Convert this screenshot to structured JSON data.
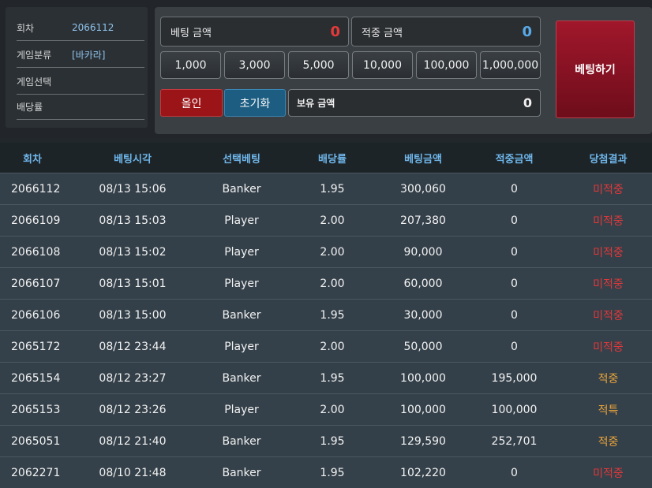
{
  "info": {
    "rows": [
      {
        "label": "회차",
        "value": "2066112"
      },
      {
        "label": "게임분류",
        "value": "[바카라]"
      },
      {
        "label": "게임선택",
        "value": ""
      },
      {
        "label": "배당률",
        "value": ""
      }
    ]
  },
  "bet": {
    "bet_amount_label": "베팅 금액",
    "bet_amount_value": "0",
    "win_amount_label": "적중 금액",
    "win_amount_value": "0",
    "chips": [
      "1,000",
      "3,000",
      "5,000",
      "10,000",
      "100,000",
      "1,000,000"
    ],
    "allin_label": "올인",
    "reset_label": "초기화",
    "holding_label": "보유 금액",
    "holding_value": "0",
    "submit_label": "베팅하기"
  },
  "colors": {
    "bet_amount": "#e23a3a",
    "win_amount": "#58a9e6",
    "header_text": "#6fb6ea",
    "result_miss": "#e0383b",
    "result_hit": "#e8a33a"
  },
  "table": {
    "headers": [
      "회차",
      "베팅시각",
      "선택베팅",
      "배당률",
      "베팅금액",
      "적중금액",
      "당첨결과"
    ],
    "rows": [
      [
        "2066112",
        "08/13 15:06",
        "Banker",
        "1.95",
        "300,060",
        "0",
        "미적중"
      ],
      [
        "2066109",
        "08/13 15:03",
        "Player",
        "2.00",
        "207,380",
        "0",
        "미적중"
      ],
      [
        "2066108",
        "08/13 15:02",
        "Player",
        "2.00",
        "90,000",
        "0",
        "미적중"
      ],
      [
        "2066107",
        "08/13 15:01",
        "Player",
        "2.00",
        "60,000",
        "0",
        "미적중"
      ],
      [
        "2066106",
        "08/13 15:00",
        "Banker",
        "1.95",
        "30,000",
        "0",
        "미적중"
      ],
      [
        "2065172",
        "08/12 23:44",
        "Player",
        "2.00",
        "50,000",
        "0",
        "미적중"
      ],
      [
        "2065154",
        "08/12 23:27",
        "Banker",
        "1.95",
        "100,000",
        "195,000",
        "적중"
      ],
      [
        "2065153",
        "08/12 23:26",
        "Player",
        "2.00",
        "100,000",
        "100,000",
        "적특"
      ],
      [
        "2065051",
        "08/12 21:40",
        "Banker",
        "1.95",
        "129,590",
        "252,701",
        "적중"
      ],
      [
        "2062271",
        "08/10 21:48",
        "Banker",
        "1.95",
        "102,220",
        "0",
        "미적중"
      ]
    ]
  }
}
